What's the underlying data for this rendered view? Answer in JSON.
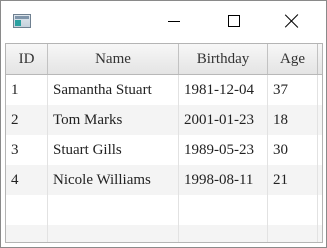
{
  "window": {
    "icon": "app-window-icon",
    "controls": {
      "minimize": "minimize-icon",
      "maximize": "maximize-icon",
      "close": "close-icon"
    }
  },
  "table": {
    "columns": [
      "ID",
      "Name",
      "Birthday",
      "Age"
    ],
    "rows": [
      {
        "id": "1",
        "name": "Samantha Stuart",
        "birthday": "1981-12-04",
        "age": "37"
      },
      {
        "id": "2",
        "name": "Tom Marks",
        "birthday": "2001-01-23",
        "age": "18"
      },
      {
        "id": "3",
        "name": "Stuart Gills",
        "birthday": "1989-05-23",
        "age": "30"
      },
      {
        "id": "4",
        "name": "Nicole Williams",
        "birthday": "1998-08-11",
        "age": "21"
      }
    ]
  }
}
